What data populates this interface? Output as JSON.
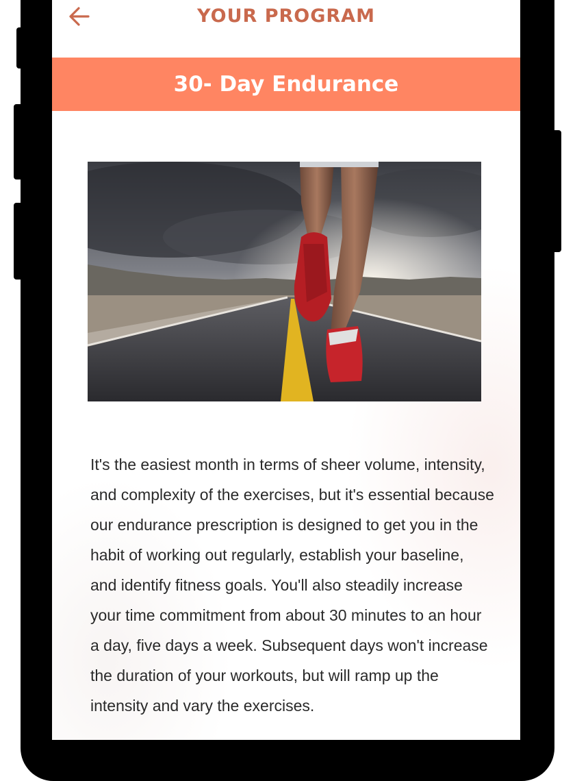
{
  "header": {
    "title": "YOUR PROGRAM",
    "back_icon": "arrow-left-icon",
    "accent_color": "#c9694d"
  },
  "program": {
    "name": "30- Day Endurance",
    "banner_color": "#ff8562",
    "image_description_icon": "runner-on-road-photo",
    "description": "It's the easiest month in terms of sheer volume, intensity, and complexity of the exercises, but it's essential because our endurance prescription is designed to get you in the habit of working out regularly, establish your baseline, and identify fitness goals. You'll also steadily increase your time commitment from about 30 minutes to an hour a day, five days a week. Subsequent days won't increase the duration of your workouts, but will ramp up the intensity and vary the exercises."
  }
}
